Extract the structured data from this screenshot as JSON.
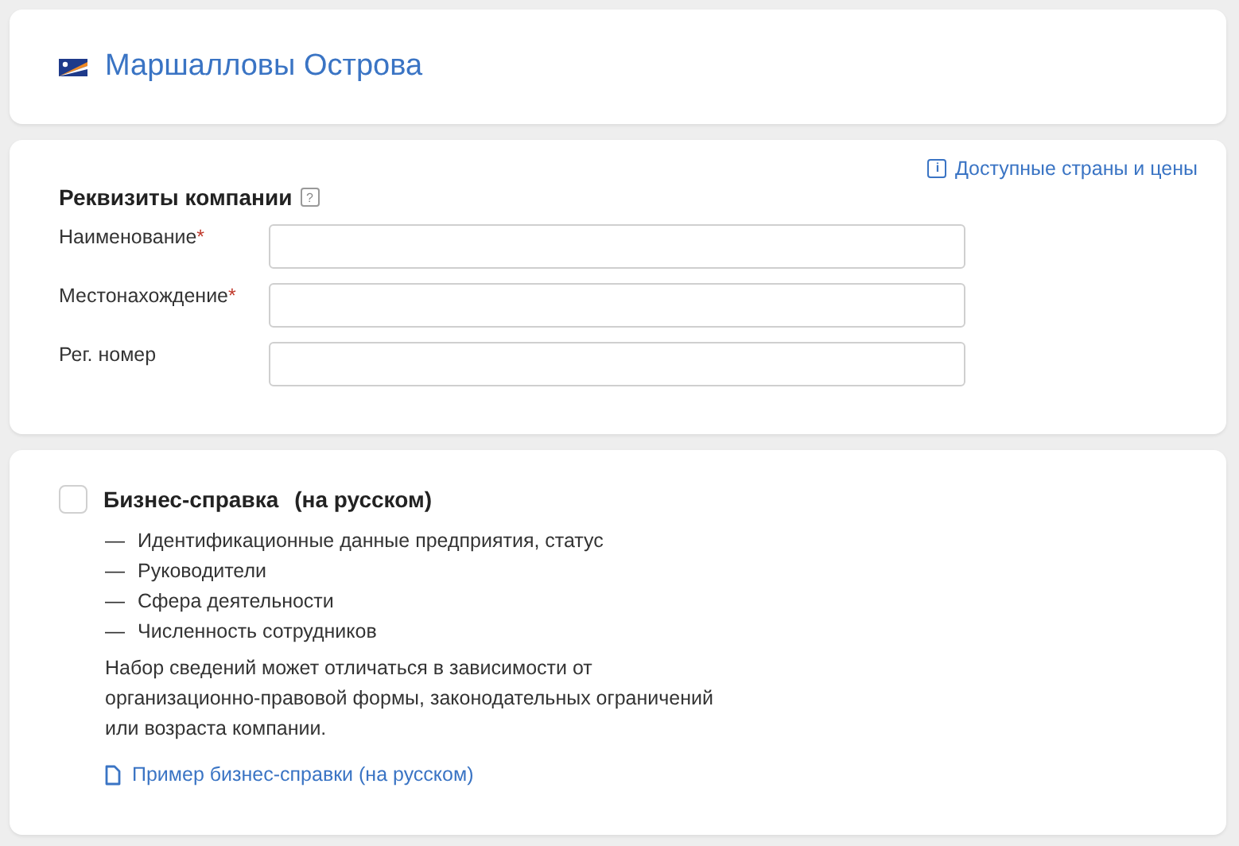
{
  "header": {
    "title": "Маршалловы Острова"
  },
  "company": {
    "title": "Реквизиты компании",
    "help": "?",
    "link": "Доступные страны и цены",
    "info": "i",
    "fields": [
      {
        "label": "Наименование",
        "marker": "*"
      },
      {
        "label": "Местонахождение",
        "marker": "*"
      },
      {
        "label": "Рег. номер"
      }
    ]
  },
  "report": {
    "checked": false,
    "title": "Бизнес-справка",
    "subtitle": "(на русском)",
    "items": [
      {
        "dash": "—",
        "text": "Идентификационные данные предприятия, статус"
      },
      {
        "dash": "—",
        "text": "Руководители"
      },
      {
        "dash": "—",
        "text": "Сфера деятельности"
      },
      {
        "dash": "—",
        "text": "Численность сотрудников"
      }
    ],
    "note": "Набор сведений может отличаться в зависимости от организационно-правовой формы, законодательных ограничений или возраста компании.",
    "link": "Пример бизнес-справки (на русском)"
  }
}
